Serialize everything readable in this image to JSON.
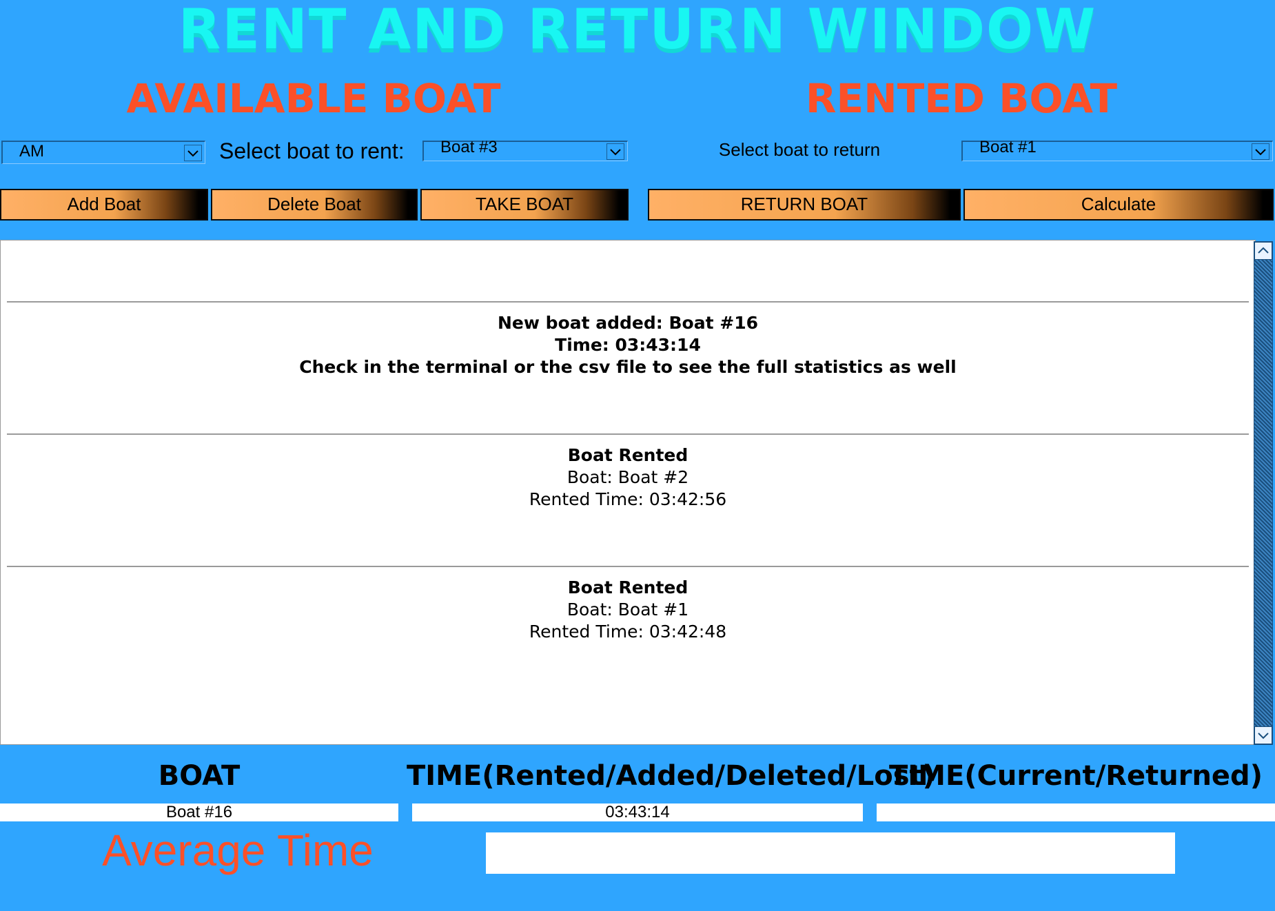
{
  "title": "RENT AND RETURN WINDOW",
  "available": {
    "heading": "AVAILABLE BOAT",
    "period_select": "AM",
    "rent_label": "Select boat to rent:",
    "rent_select": "Boat #3"
  },
  "rented": {
    "heading": "RENTED BOAT",
    "return_label": "Select boat to return",
    "return_select": "Boat #1"
  },
  "buttons": {
    "add": "Add Boat",
    "delete": "Delete Boat",
    "take": "TAKE BOAT",
    "return": "RETURN  BOAT",
    "calculate": "Calculate"
  },
  "log": [
    {
      "title": "New boat added: Boat #16",
      "line1": "Time: 03:43:14",
      "line2": "Check in the terminal or the csv file to see the full statistics as well"
    },
    {
      "title": "Boat Rented",
      "line1": "Boat: Boat #2",
      "line2": "Rented Time: 03:42:56"
    },
    {
      "title": "Boat Rented",
      "line1": "Boat: Boat #1",
      "line2": "Rented Time: 03:42:48"
    }
  ],
  "table": {
    "headers": [
      "BOAT",
      "TIME(Rented/Added/Deleted/Lost)",
      "TIME(Current/Returned)"
    ],
    "row": [
      "Boat #16",
      "03:43:14",
      ""
    ]
  },
  "average": {
    "label": "Average Time",
    "value": ""
  },
  "colors": {
    "background": "#2fa5fe",
    "title": "#19f6f2",
    "heading": "#fb5028",
    "button": "#f3a34f"
  }
}
